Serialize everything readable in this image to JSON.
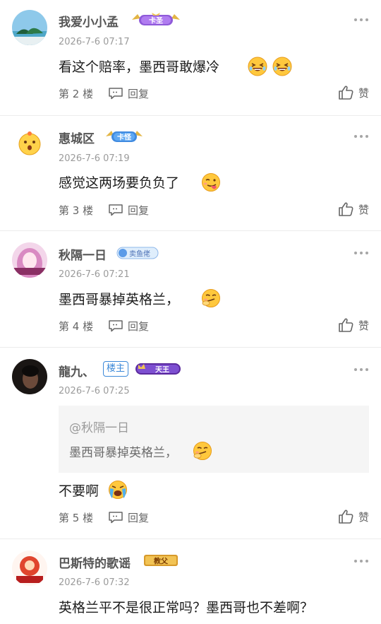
{
  "posts": [
    {
      "username": "我爱小小孟",
      "badge_label": "卡圣",
      "time": "2026-7-6 07:17",
      "content": "看这个赔率，墨西哥敢爆冷",
      "floor": "第 2 楼",
      "reply_label": "回复",
      "like_label": "赞"
    },
    {
      "username": "惠城区",
      "badge_label": "卡怪",
      "time": "2026-7-6 07:19",
      "content": "感觉这两场要负负了",
      "floor": "第 3 楼",
      "reply_label": "回复",
      "like_label": "赞"
    },
    {
      "username": "秋隔一日",
      "badge_label": "卖鱼佬",
      "time": "2026-7-6 07:21",
      "content": "墨西哥暴掉英格兰，",
      "floor": "第 4 楼",
      "reply_label": "回复",
      "like_label": "赞"
    },
    {
      "username": "龍九、",
      "owner_tag": "楼主",
      "badge_label": "天王",
      "time": "2026-7-6 07:25",
      "quote_user": "@秋隔一日",
      "quote_text": "墨西哥暴掉英格兰，",
      "content": "不要啊",
      "floor": "第 5 楼",
      "reply_label": "回复",
      "like_label": "赞"
    },
    {
      "username": "巴斯特的歌谣",
      "badge_label": "教父",
      "time": "2026-7-6 07:32",
      "content": "英格兰平不是很正常吗？墨西哥也不差啊？"
    }
  ],
  "icons": {
    "more": "more-dots-icon",
    "reply": "reply-icon",
    "like": "thumbs-up-icon"
  },
  "colors": {
    "owner_tag": "#3b88d8",
    "quote_bg": "#f5f5f5",
    "badge_gold": "#e3b544",
    "badge_purple": "#7d4fd1",
    "badge_blue": "#5a9be8"
  }
}
